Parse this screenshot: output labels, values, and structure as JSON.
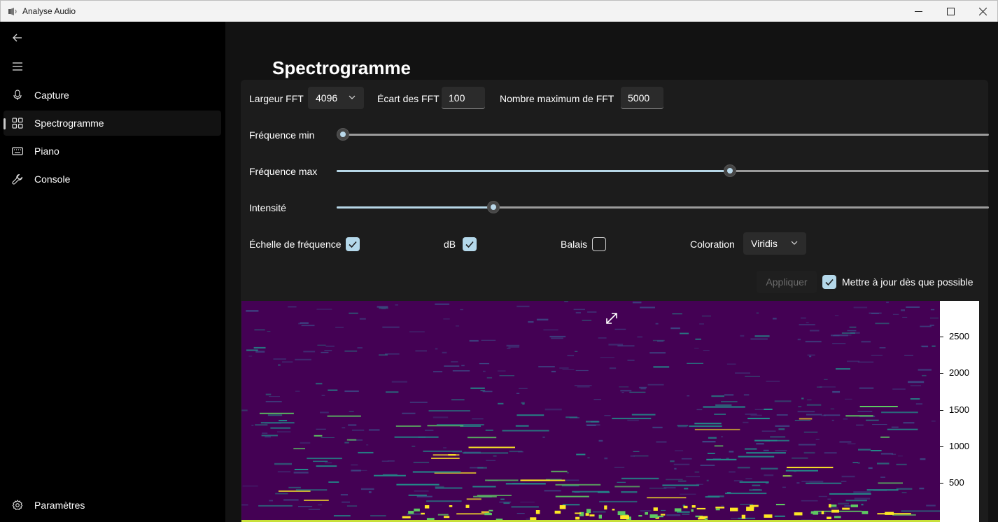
{
  "window": {
    "title": "Analyse Audio"
  },
  "sidebar": {
    "items": [
      {
        "label": "Capture",
        "icon": "microphone-icon"
      },
      {
        "label": "Spectrogramme",
        "icon": "grid-icon",
        "active": true
      },
      {
        "label": "Piano",
        "icon": "keyboard-icon"
      },
      {
        "label": "Console",
        "icon": "wrench-icon"
      }
    ],
    "settings_label": "Paramètres"
  },
  "page": {
    "title": "Spectrogramme"
  },
  "fft": {
    "width_label": "Largeur FFT",
    "width_value": "4096",
    "gap_label": "Écart des FFT",
    "gap_value": "100",
    "max_label": "Nombre maximum de FFT",
    "max_value": "5000"
  },
  "sliders": {
    "freq_min": {
      "label": "Fréquence min",
      "fraction": 0.01
    },
    "freq_max": {
      "label": "Fréquence max",
      "fraction": 0.603
    },
    "intensity": {
      "label": "Intensité",
      "fraction": 0.24
    }
  },
  "options": {
    "freq_scale_label": "Échelle de fréquence",
    "freq_scale_checked": true,
    "db_label": "dB",
    "db_checked": true,
    "sweep_label": "Balais",
    "sweep_checked": false,
    "coloring_label": "Coloration",
    "coloring_value": "Viridis"
  },
  "actions": {
    "apply_label": "Appliquer",
    "auto_update_label": "Mettre à jour dès que possible",
    "auto_update_checked": true
  },
  "spectrogram": {
    "colormap": [
      "#440154",
      "#3b528b",
      "#21918c",
      "#5ec962",
      "#fde725"
    ],
    "y_ticks": [
      "2500",
      "2000",
      "1500",
      "1000",
      "500"
    ]
  }
}
